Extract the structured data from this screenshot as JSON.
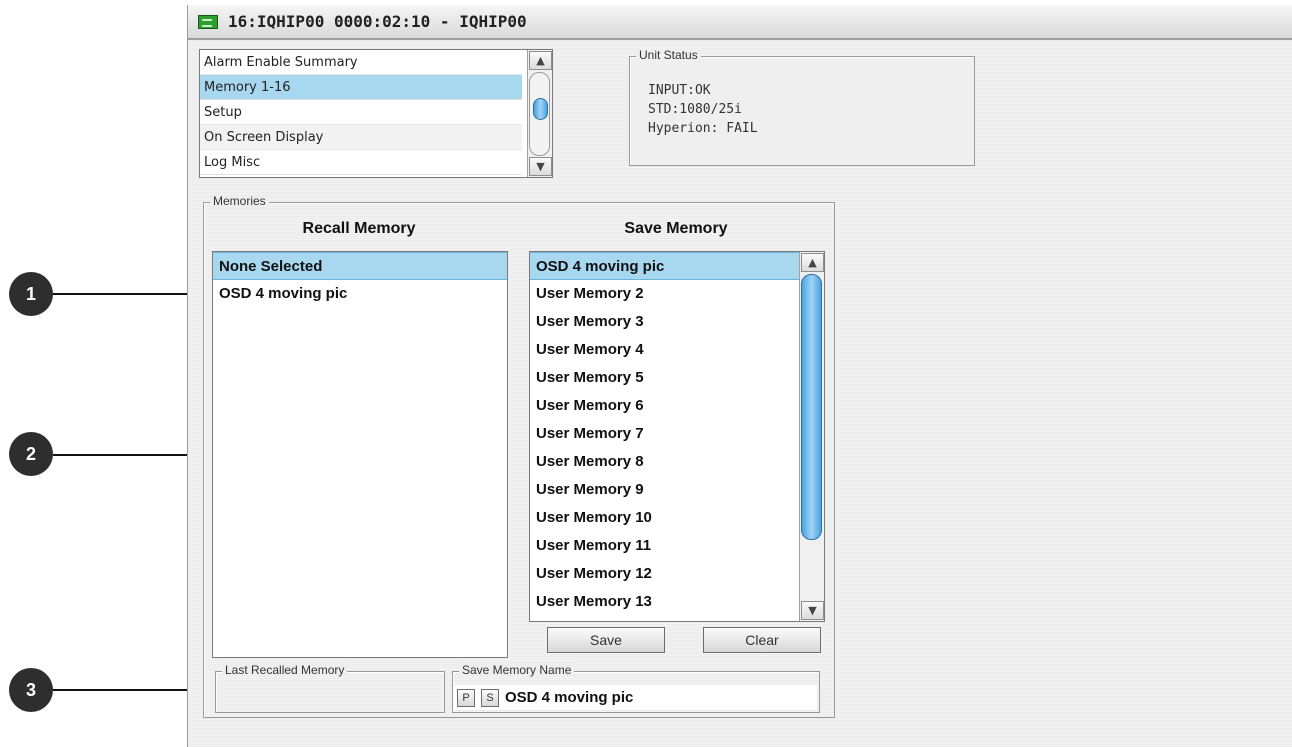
{
  "window": {
    "title": "16:IQHIP00  0000:02:10  - IQHIP00"
  },
  "menu": {
    "items": [
      {
        "label": "Alarm Enable Summary"
      },
      {
        "label": "Memory 1-16"
      },
      {
        "label": "Setup"
      },
      {
        "label": "On Screen Display"
      },
      {
        "label": "Log Misc"
      }
    ],
    "selected": "Memory 1-16"
  },
  "unit_status": {
    "title": "Unit Status",
    "lines": [
      "INPUT:OK",
      "STD:1080/25i",
      "Hyperion: FAIL"
    ]
  },
  "memories": {
    "group_title": "Memories",
    "recall": {
      "header": "Recall Memory",
      "items": [
        "None Selected",
        "OSD 4 moving pic"
      ],
      "selected": "None Selected"
    },
    "save": {
      "header": "Save Memory",
      "items": [
        "OSD 4 moving pic",
        "User Memory 2",
        "User Memory 3",
        "User Memory 4",
        "User Memory 5",
        "User Memory 6",
        "User Memory 7",
        "User Memory 8",
        "User Memory 9",
        "User Memory 10",
        "User Memory 11",
        "User Memory 12",
        "User Memory 13"
      ],
      "selected": "OSD 4 moving pic"
    },
    "buttons": {
      "save": "Save",
      "clear": "Clear"
    },
    "last_recalled": {
      "title": "Last Recalled Memory",
      "value": ""
    },
    "save_name": {
      "title": "Save Memory Name",
      "btn_p": "P",
      "btn_s": "S",
      "value": "OSD 4 moving pic"
    }
  },
  "callouts": [
    "1",
    "2",
    "3"
  ],
  "icons": {
    "window_icon": "app-icon",
    "scroll_up": "chevron-up-icon",
    "scroll_down": "chevron-down-icon"
  },
  "colors": {
    "selection": "#a8d8f0",
    "scroll_thumb": "#4aa3e0"
  }
}
